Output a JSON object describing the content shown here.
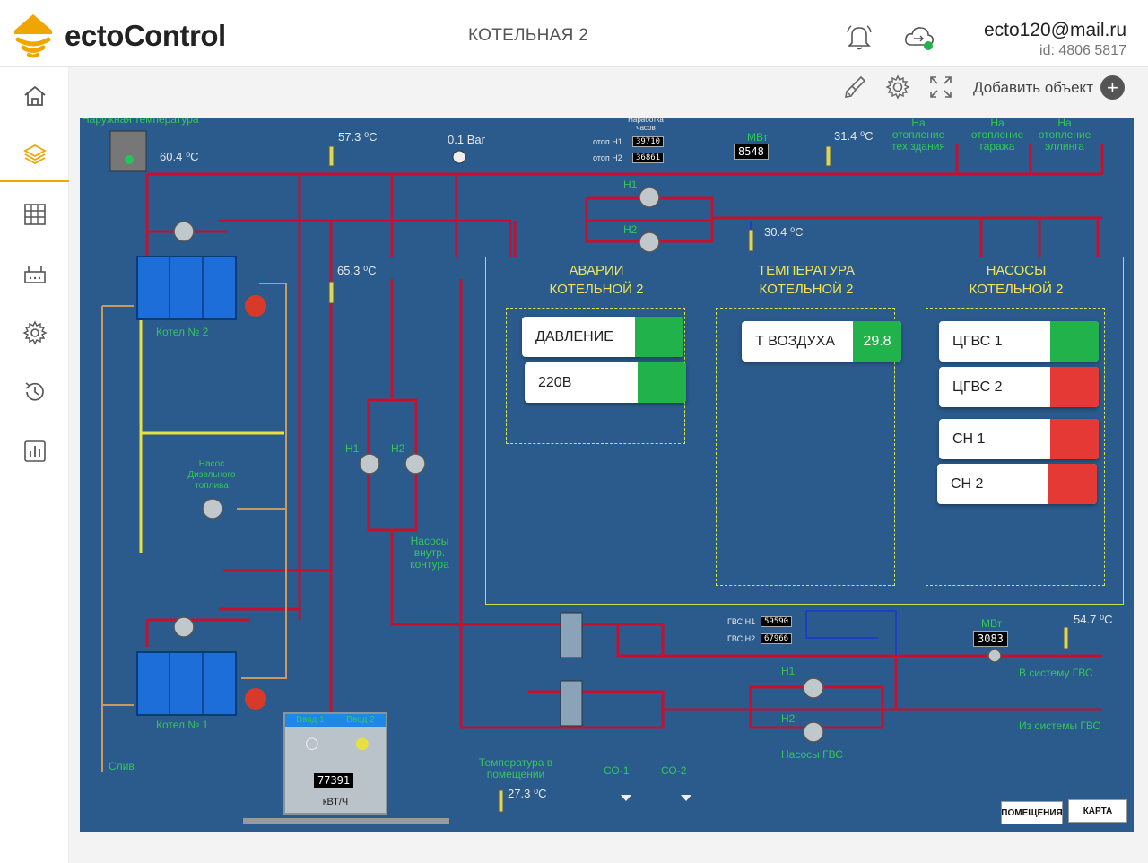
{
  "header": {
    "brand": "ectoControl",
    "title": "КОТЕЛЬНАЯ 2",
    "user_email": "ecto120@mail.ru",
    "user_id": "id: 4806 5817",
    "colors": {
      "brand_accent": "#f0a500",
      "online_dot": "#22b24c"
    }
  },
  "sidebar": {
    "items": [
      {
        "icon": "home-icon"
      },
      {
        "icon": "layers-icon",
        "active": true
      },
      {
        "icon": "grid-icon"
      },
      {
        "icon": "controller-icon"
      },
      {
        "icon": "settings-icon"
      },
      {
        "icon": "history-icon"
      },
      {
        "icon": "chart-icon"
      }
    ]
  },
  "toolbar": {
    "add_object_label": "Добавить объект"
  },
  "scheme": {
    "outdoor_temp_label": "Наружная температура",
    "outdoor_temp": "60.4",
    "temp_unit": "⁰C",
    "temp_top_1": "57.3",
    "pressure": "0.1",
    "pressure_unit": "Bar",
    "hours_label": "Наработка часов",
    "hours_h1_label": "отоп Н1",
    "hours_h1": "39710",
    "hours_h2_label": "отоп Н2",
    "hours_h2": "36861",
    "mw_label": "МВт",
    "mw_top": "8548",
    "temp_top_2": "31.4",
    "heating_tech": "На отопление тех.здания",
    "heating_garage": "На отопление гаража",
    "heating_slipway": "На отопление эллинга",
    "temp_pipe": "30.4",
    "temp_boiler": "65.3",
    "pump_h1": "Н1",
    "pump_h2": "Н2",
    "boiler_2": "Котел № 2",
    "boiler_1": "Котел № 1",
    "diesel_pump": "Насос Дизельного топлива",
    "inner_pumps": "Насосы внутр. контура",
    "drain": "Слив",
    "dhw_hours_h1_label": "ГВС Н1",
    "dhw_hours_h1": "59590",
    "dhw_hours_h2_label": "ГВС Н2",
    "dhw_hours_h2": "67966",
    "mw_bottom": "3083",
    "temp_dhw": "54.7",
    "to_dhw": "В систему ГВС",
    "from_dhw": "Из системы ГВС",
    "dhw_pumps": "Насосы ГВС",
    "room_temp_label": "Температура в помещении",
    "room_temp": "27.3",
    "co1": "СО-1",
    "co2": "СО-2",
    "meter_input_1": "Ввод 1",
    "meter_input_2": "Ввод 2",
    "meter_value": "77391",
    "meter_unit": "кВТ/Ч",
    "btn_rooms": "ПОМЕЩЕНИЯ",
    "btn_map": "КАРТА"
  },
  "panels": {
    "alarms_title_1": "АВАРИИ",
    "alarms_title_2": "КОТЕЛЬНОЙ 2",
    "temp_title_1": "ТЕМПЕРАТУРА",
    "temp_title_2": "КОТЕЛЬНОЙ 2",
    "pumps_title_1": "НАСОСЫ",
    "pumps_title_2": "КОТЕЛЬНОЙ 2",
    "alarms": [
      {
        "label": "ДАВЛЕНИЕ",
        "status": "ok"
      },
      {
        "label": "220В",
        "status": "ok"
      }
    ],
    "temps": [
      {
        "label": "Т ВОЗДУХА",
        "value": "29.8"
      }
    ],
    "pumps": [
      {
        "label": "ЦГВС 1",
        "status": "ok"
      },
      {
        "label": "ЦГВС 2",
        "status": "bad"
      },
      {
        "label": "СН 1",
        "status": "bad"
      },
      {
        "label": "СН 2",
        "status": "bad"
      }
    ]
  }
}
